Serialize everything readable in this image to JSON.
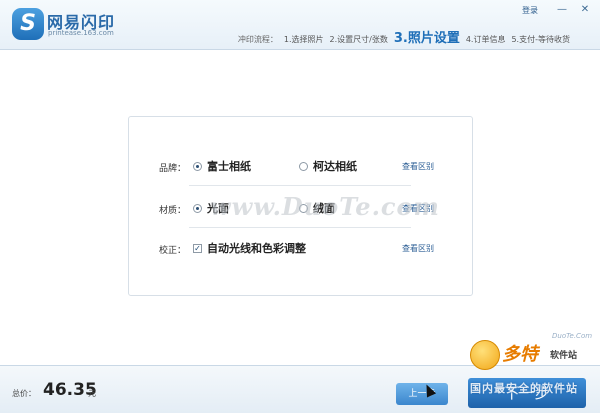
{
  "app": {
    "name": "网易闪印",
    "url": "printease.163.com",
    "logo_glyph": "S"
  },
  "window": {
    "login": "登录",
    "minimize": "—",
    "close": "✕"
  },
  "steps": {
    "label": "冲印流程：",
    "items": [
      {
        "text": "1.选择照片",
        "active": false
      },
      {
        "text": "2.设置尺寸/张数",
        "active": false
      },
      {
        "text": "3.照片设置",
        "active": true
      },
      {
        "text": "4.订单信息",
        "active": false
      },
      {
        "text": "5.支付-等待收货",
        "active": false
      }
    ]
  },
  "settings": {
    "brand": {
      "label": "品牌：",
      "options": [
        "富士相纸",
        "柯达相纸"
      ],
      "selected": 0,
      "view_diff": "查看区别"
    },
    "material": {
      "label": "材质：",
      "options": [
        "光面",
        "绒面"
      ],
      "selected": 0,
      "view_diff": "查看区别"
    },
    "correction": {
      "label": "校正：",
      "checkbox_label": "自动光线和色彩调整",
      "checked": true,
      "view_diff": "查看区别"
    }
  },
  "watermark": "www.DuoTe.com",
  "footer": {
    "total_label": "总价：",
    "total_value": "46.35",
    "total_unit": "元",
    "prev_button": "上一步",
    "next_button": "下一步"
  },
  "badge": {
    "url": "DuoTe.Com",
    "name": "多特",
    "sub": "软件站",
    "tag": "国内最安全的软件站"
  },
  "colors": {
    "accent": "#1f6fb8",
    "badge": "#e77c00"
  }
}
